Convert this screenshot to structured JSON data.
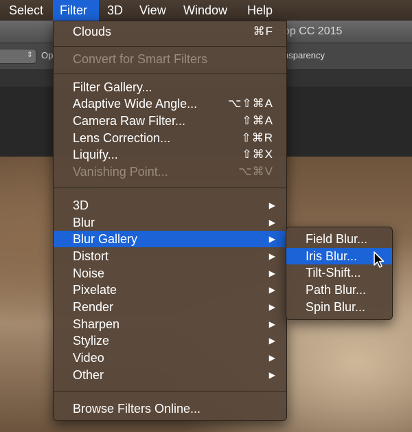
{
  "menubar": {
    "items": [
      {
        "label": "Select"
      },
      {
        "label": "Filter"
      },
      {
        "label": "3D"
      },
      {
        "label": "View"
      },
      {
        "label": "Window"
      },
      {
        "label": "Help"
      }
    ]
  },
  "app": {
    "title_fragment": "op CC 2015",
    "options_fragment": "Op",
    "transparency_fragment": "nsparency",
    "dropdown_arrow": "⇕"
  },
  "filter_menu": {
    "clouds": {
      "label": "Clouds",
      "shortcut": "⌘F"
    },
    "convert_smart": {
      "label": "Convert for Smart Filters"
    },
    "filter_gallery": {
      "label": "Filter Gallery..."
    },
    "adaptive_wide": {
      "label": "Adaptive Wide Angle...",
      "shortcut": "⌥⇧⌘A"
    },
    "camera_raw": {
      "label": "Camera Raw Filter...",
      "shortcut": "⇧⌘A"
    },
    "lens_correction": {
      "label": "Lens Correction...",
      "shortcut": "⇧⌘R"
    },
    "liquify": {
      "label": "Liquify...",
      "shortcut": "⇧⌘X"
    },
    "vanishing_point": {
      "label": "Vanishing Point...",
      "shortcut": "⌥⌘V"
    },
    "submenus": [
      {
        "label": "3D"
      },
      {
        "label": "Blur"
      },
      {
        "label": "Blur Gallery"
      },
      {
        "label": "Distort"
      },
      {
        "label": "Noise"
      },
      {
        "label": "Pixelate"
      },
      {
        "label": "Render"
      },
      {
        "label": "Sharpen"
      },
      {
        "label": "Stylize"
      },
      {
        "label": "Video"
      },
      {
        "label": "Other"
      }
    ],
    "submenu_arrow": "▶",
    "browse_online": {
      "label": "Browse Filters Online..."
    }
  },
  "blur_gallery_submenu": {
    "items": [
      {
        "label": "Field Blur..."
      },
      {
        "label": "Iris Blur..."
      },
      {
        "label": "Tilt-Shift..."
      },
      {
        "label": "Path Blur..."
      },
      {
        "label": "Spin Blur..."
      }
    ]
  },
  "colors": {
    "highlight": "#1b63d6",
    "menu_bg": "#58483a",
    "disabled_text": "#9a8b7c"
  },
  "icons": {
    "cursor": "arrow-pointer-icon"
  }
}
